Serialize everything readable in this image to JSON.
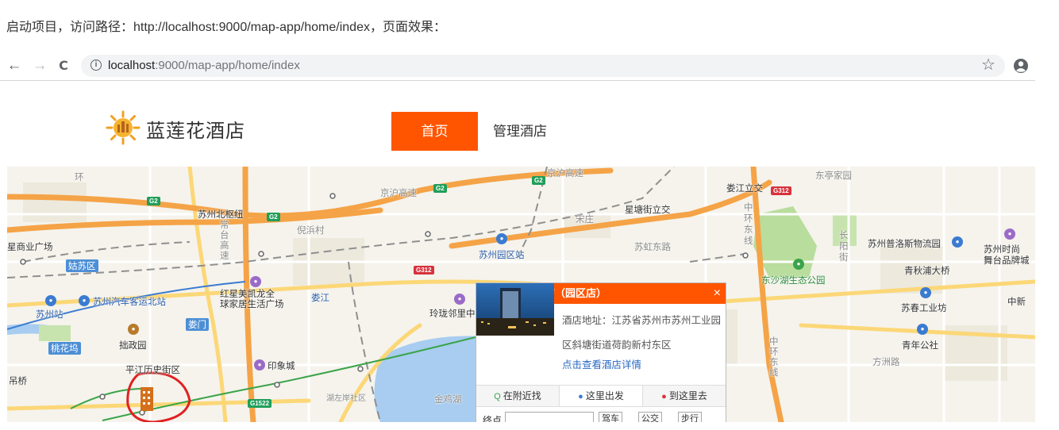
{
  "intro_text": "启动项目，访问路径：http://localhost:9000/map-app/home/index，页面效果：",
  "browser": {
    "back_icon": "←",
    "forward_icon": "→",
    "reload_icon": "C",
    "info_icon": "i",
    "url_host": "localhost",
    "url_rest": ":9000/map-app/home/index",
    "star_icon": "☆"
  },
  "header": {
    "logo_text": "蓝莲花酒店",
    "nav_home": "首页",
    "nav_manage": "管理酒店"
  },
  "map_labels": {
    "l1": "苏州北枢纽",
    "l2": "倪浜村",
    "l3": "星商业广场",
    "l4": "姑苏区",
    "l5": "苏州站",
    "l6": "苏州汽车客运北站",
    "l7": "拙政园",
    "l8": "平江历史街区",
    "l9": "桃花坞",
    "l10": "吊桥",
    "l11": "娄门",
    "l12": "红星美凯龙全\n球家居生活广场",
    "l13": "娄江",
    "l14": "印象城",
    "l15": "湖左岸社区",
    "l16": "金鸡湖",
    "l17": "玲珑邻里中心",
    "l18": "苏州园区站",
    "l19": "京沪高速",
    "l20": "京沪高速",
    "l21": "宋庄",
    "l22": "星塘街立交",
    "l23": "苏虹东路",
    "l24": "娄江立交",
    "l25": "东亭家园",
    "l26": "中环东线",
    "l27": "东沙湖生态公园",
    "l28": "长阳街",
    "l29": "苏州普洛斯物流园",
    "l30": "苏州时尚\n舞台品牌城",
    "l31": "青秋浦大桥",
    "l32": "苏春工业坊",
    "l33": "中新",
    "l34": "青年公社",
    "l35": "方洲路",
    "l36": "中环东线",
    "l37": "环",
    "l38": "常台高速"
  },
  "shields": {
    "g2a": "G2",
    "g2b": "G2",
    "g2c": "G2",
    "g2d": "G2",
    "g312a": "G312",
    "g312b": "G312",
    "g312c": "G312",
    "g1522": "G1522"
  },
  "popup": {
    "title": "苏州蓝莲花酒店（园区店）",
    "close_icon": "×",
    "address": "酒店地址：江苏省苏州市苏州工业园区斜塘街道荷韵新村东区",
    "detail_link": "点击查看酒店详情",
    "tabs": [
      {
        "icon": "Q",
        "label": "在附近找"
      },
      {
        "icon": "●",
        "label": "这里出发"
      },
      {
        "icon": "●",
        "label": "到这里去"
      }
    ],
    "bottom_label": "终点",
    "bottom_buttons": [
      "驾车",
      "公交",
      "步行"
    ]
  },
  "colors": {
    "accent": "#ff5500",
    "highway": "#f5a347",
    "road": "#fcd777",
    "water": "#a8cdf0",
    "park": "#b9dd9c"
  }
}
